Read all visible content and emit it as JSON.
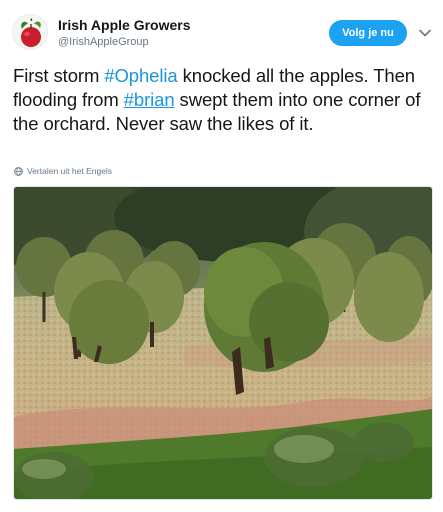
{
  "author": {
    "name": "Irish Apple Growers",
    "handle": "@IrishAppleGroup",
    "avatar_icon": "apple-icon"
  },
  "follow_button": {
    "label": "Volg je nu",
    "color": "#1da1f2"
  },
  "menu_icon": "chevron-down-icon",
  "tweet": {
    "text_1": "First storm ",
    "hashtag_1": "#Ophelia",
    "text_2": " knocked all the apples. Then flooding from ",
    "hashtag_2": "#brian",
    "text_3": " swept them into one corner of the orchard. Never saw the likes of it.",
    "link_color": "#1b95e0"
  },
  "translate": {
    "label": "Vertalen uit het Engels",
    "icon": "globe-icon"
  },
  "media": {
    "type": "photo",
    "subject": "orchard"
  }
}
